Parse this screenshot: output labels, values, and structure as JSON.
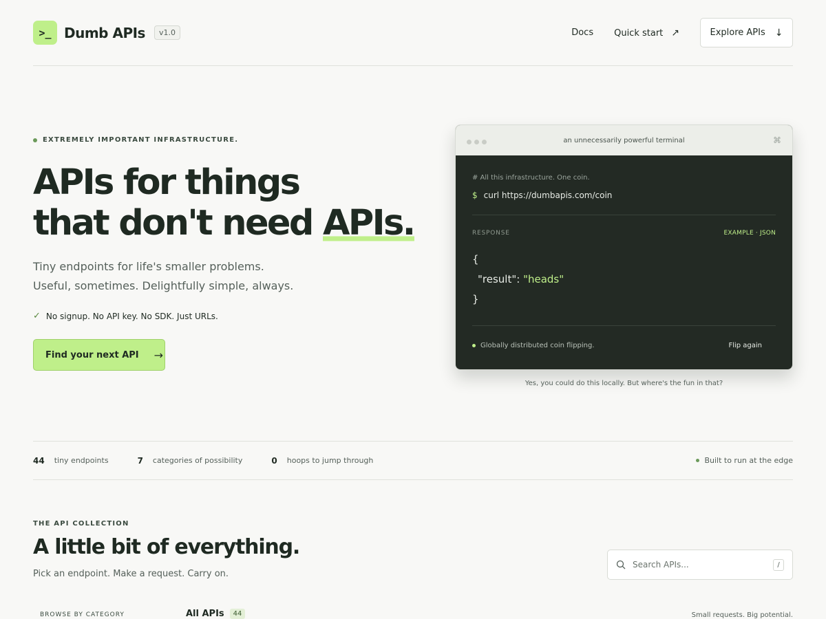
{
  "header": {
    "logo_text": ">_",
    "brand": "Dumb APIs",
    "version": "v1.0",
    "nav": {
      "docs": "Docs",
      "quick_start": "Quick start",
      "explore": "Explore APIs"
    }
  },
  "hero": {
    "eyebrow": "EXTREMELY IMPORTANT INFRASTRUCTURE.",
    "title_line1": "APIs for things",
    "title_line2_pre": "that don't need ",
    "title_line2_hl": "APIs.",
    "sub_line1": "Tiny endpoints for life's smaller problems.",
    "sub_line2": "Useful, sometimes. Delightfully simple, always.",
    "check_text": "No signup. No API key. No SDK. Just URLs.",
    "cta_label": "Find your next API"
  },
  "terminal": {
    "title": "an unnecessarily powerful terminal",
    "comment": "# All this infrastructure. One coin.",
    "prompt": "$",
    "command": "curl https://dumbapis.com/coin",
    "response_label": "RESPONSE",
    "response_meta": "EXAMPLE · JSON",
    "json_open": "{",
    "json_key": "\"result\"",
    "json_colon": ": ",
    "json_value": "\"heads\"",
    "json_close": "}",
    "footer_text": "Globally distributed coin flipping.",
    "flip_label": "Flip again",
    "caption": "Yes, you could do this locally. But where's the fun in that?"
  },
  "stats": [
    {
      "num": "44",
      "label": "tiny endpoints"
    },
    {
      "num": "7",
      "label": "categories of possibility"
    },
    {
      "num": "0",
      "label": "hoops to jump through"
    }
  ],
  "edge_text": "Built to run at the edge",
  "collection": {
    "eyebrow": "THE API COLLECTION",
    "title": "A little bit of everything.",
    "subtitle": "Pick an endpoint. Make a request. Carry on.",
    "search_placeholder": "Search APIs...",
    "search_kbd": "/",
    "browse_label": "BROWSE BY CATEGORY",
    "all_label": "All APIs",
    "all_count": "44",
    "tagline": "Small requests. Big potential."
  },
  "icons": {
    "quick_start_arrow": "↗",
    "explore_arrow": "↓",
    "cta_arrow": "→",
    "check": "✓",
    "cmd": "⌘"
  },
  "colors": {
    "accent": "#bfef8a",
    "background": "#f8f8f6",
    "terminal_bg": "#232a24",
    "text": "#1f2a22"
  }
}
